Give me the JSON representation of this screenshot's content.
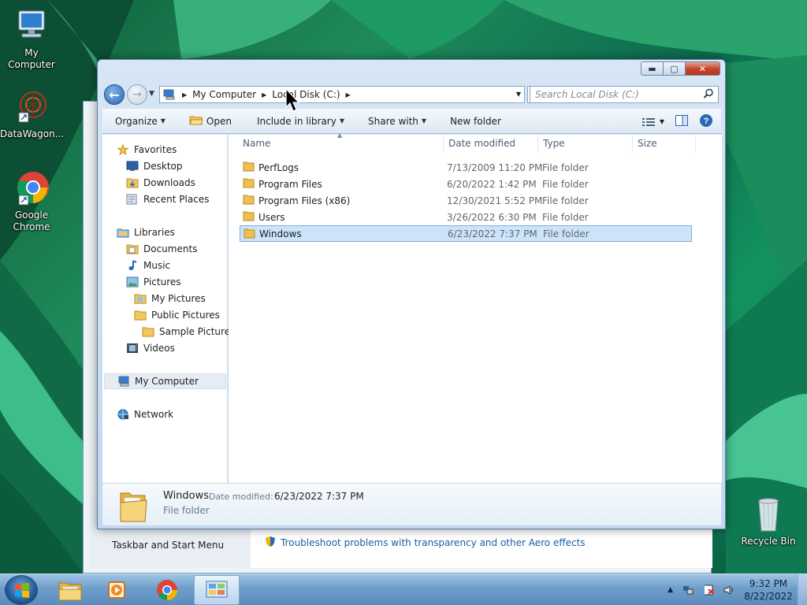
{
  "desktop": {
    "icons": [
      {
        "label": "My Computer",
        "icon": "computer-icon"
      },
      {
        "label": "DataWagon...",
        "icon": "datawagon-icon"
      },
      {
        "label": "Google Chrome",
        "icon": "chrome-icon"
      },
      {
        "label": "Recycle Bin",
        "icon": "recycle-bin-icon"
      }
    ]
  },
  "background_window": {
    "left_link": "Taskbar and Start Menu",
    "troubleshoot_link": "Troubleshoot problems with transparency and other Aero effects"
  },
  "explorer": {
    "caption_buttons": {
      "minimize": "minimize",
      "maximize": "maximize",
      "close": "close"
    },
    "address": {
      "crumbs": [
        "My Computer",
        "Local Disk (C:)"
      ]
    },
    "search": {
      "placeholder": "Search Local Disk (C:)"
    },
    "toolbar": {
      "organize": "Organize",
      "open": "Open",
      "include_in_library": "Include in library",
      "share_with": "Share with",
      "new_folder": "New folder"
    },
    "nav": {
      "favorites": "Favorites",
      "desktop": "Desktop",
      "downloads": "Downloads",
      "recent_places": "Recent Places",
      "libraries": "Libraries",
      "documents": "Documents",
      "music": "Music",
      "pictures": "Pictures",
      "my_pictures": "My Pictures",
      "public_pictures": "Public Pictures",
      "sample_pictures": "Sample Pictures",
      "videos": "Videos",
      "my_computer": "My Computer",
      "network": "Network"
    },
    "columns": {
      "name": "Name",
      "date_modified": "Date modified",
      "type": "Type",
      "size": "Size"
    },
    "files": [
      {
        "name": "PerfLogs",
        "date": "7/13/2009 11:20 PM",
        "type": "File folder"
      },
      {
        "name": "Program Files",
        "date": "6/20/2022 1:42 PM",
        "type": "File folder"
      },
      {
        "name": "Program Files (x86)",
        "date": "12/30/2021 5:52 PM",
        "type": "File folder"
      },
      {
        "name": "Users",
        "date": "3/26/2022 6:30 PM",
        "type": "File folder"
      },
      {
        "name": "Windows",
        "date": "6/23/2022 7:37 PM",
        "type": "File folder"
      }
    ],
    "details": {
      "name": "Windows",
      "date_label": "Date modified:",
      "date": "6/23/2022 7:37 PM",
      "type": "File folder"
    }
  },
  "taskbar": {
    "clock_time": "9:32 PM",
    "clock_date": "8/22/2022"
  }
}
